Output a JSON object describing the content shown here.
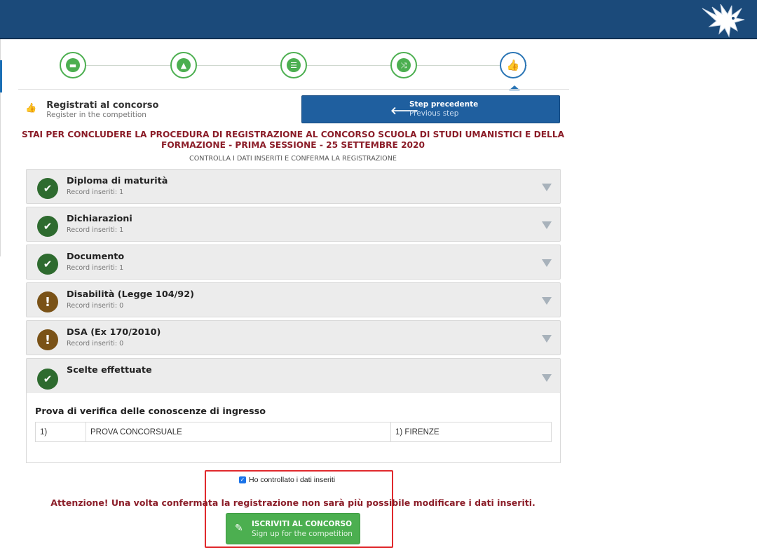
{
  "header": {
    "logo_icon": "eagle-logo"
  },
  "steps": [
    {
      "icon": "folder-open-icon",
      "glyph": "▬",
      "state": "done"
    },
    {
      "icon": "graduation-cap-icon",
      "glyph": "▲",
      "state": "done"
    },
    {
      "icon": "list-icon",
      "glyph": "☰",
      "state": "done"
    },
    {
      "icon": "shuffle-icon",
      "glyph": "⤨",
      "state": "done"
    },
    {
      "icon": "thumbs-up-icon",
      "glyph": "👍",
      "state": "active"
    }
  ],
  "registration": {
    "title": "Registrati al concorso",
    "subtitle": "Register in the competition",
    "icon_glyph": "👍"
  },
  "prev_button": {
    "label": "Step precedente",
    "sublabel": "Previous step",
    "arrow": "🡐"
  },
  "main_title": "STAI PER CONCLUDERE LA PROCEDURA DI REGISTRAZIONE AL CONCORSO SCUOLA DI STUDI UMANISTICI E DELLA FORMAZIONE - PRIMA SESSIONE - 25 SETTEMBRE 2020",
  "sub_title": "CONTROLLA I DATI INSERITI E CONFERMA LA REGISTRAZIONE",
  "sections": [
    {
      "title": "Diploma di maturità",
      "count": "Record inseriti: 1",
      "status": "ok",
      "glyph": "✔"
    },
    {
      "title": "Dichiarazioni",
      "count": "Record inseriti: 1",
      "status": "ok",
      "glyph": "✔"
    },
    {
      "title": "Documento",
      "count": "Record inseriti: 1",
      "status": "ok",
      "glyph": "✔"
    },
    {
      "title": "Disabilità (Legge 104/92)",
      "count": "Record inseriti: 0",
      "status": "warn",
      "glyph": "!"
    },
    {
      "title": "DSA (Ex 170/2010)",
      "count": "Record inseriti: 0",
      "status": "warn",
      "glyph": "!"
    },
    {
      "title": "Scelte effettuate",
      "count": "",
      "status": "ok",
      "glyph": "✔"
    }
  ],
  "choices": {
    "title": "Prova di verifica delle conoscenze di ingresso",
    "row": {
      "num": "1)",
      "name": "PROVA CONCORSUALE",
      "place": "1) FIRENZE"
    }
  },
  "confirm": {
    "check_label": "Ho controllato i dati inseriti",
    "check_glyph": "✓",
    "warning": "Attenzione! Una volta confermata la registrazione non sarà più possibile modificare i dati inseriti.",
    "submit_label": "ISCRIVITI AL CONCORSO",
    "submit_sublabel": "Sign up for the competition",
    "submit_icon_glyph": "✎"
  }
}
